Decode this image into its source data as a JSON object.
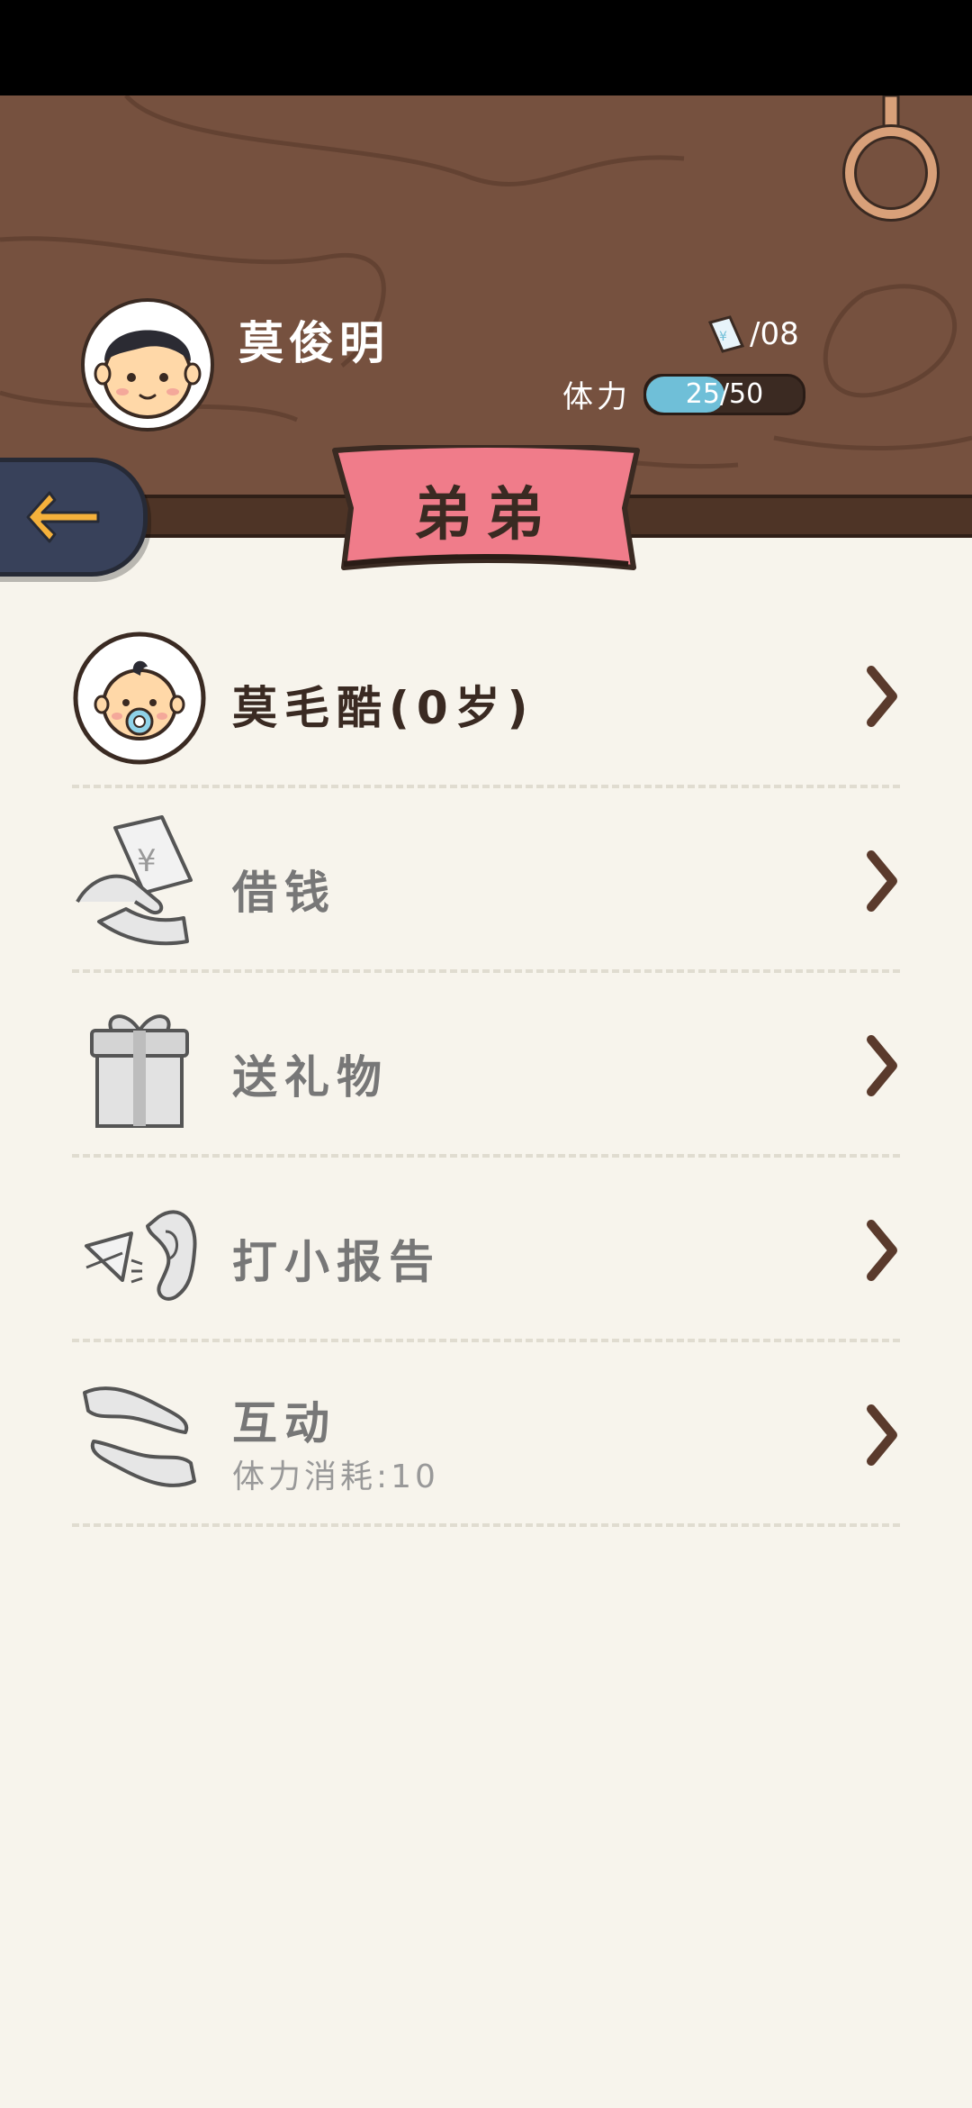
{
  "header": {
    "player_name": "莫俊明",
    "money_text": "/08",
    "stamina_label": "体力",
    "stamina_value": "25/50",
    "stamina_fraction": 0.5,
    "title": "弟弟"
  },
  "items": [
    {
      "label": "莫毛酷(0岁)",
      "icon": "baby-avatar-icon"
    },
    {
      "label": "借钱",
      "icon": "money-hand-icon"
    },
    {
      "label": "送礼物",
      "icon": "gift-icon"
    },
    {
      "label": "打小报告",
      "icon": "ear-whisper-icon"
    },
    {
      "label": "互动",
      "sub": "体力消耗:10",
      "icon": "interact-icon"
    }
  ],
  "colors": {
    "wood": "#76513f",
    "ribbon": "#f07c8a",
    "stamina_fill": "#6fbfd8",
    "back_button": "#38415a",
    "arrow": "#f5b13b"
  }
}
